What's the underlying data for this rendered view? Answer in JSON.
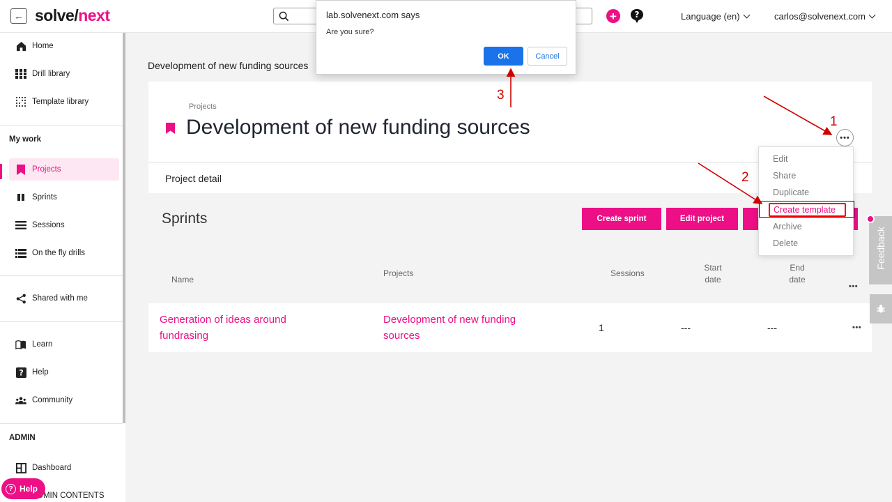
{
  "topbar": {
    "logo_part1": "solve/",
    "logo_part2": "next",
    "language": "Language (en)",
    "user_email": "carlos@solvenext.com"
  },
  "sidebar": {
    "items": [
      {
        "label": "Home"
      },
      {
        "label": "Drill library"
      },
      {
        "label": "Template library"
      }
    ],
    "my_work_label": "My work",
    "work_items": [
      {
        "label": "Projects"
      },
      {
        "label": "Sprints"
      },
      {
        "label": "Sessions"
      },
      {
        "label": "On the fly drills"
      }
    ],
    "shared_label": "Shared with me",
    "support_items": [
      {
        "label": "Learn"
      },
      {
        "label": "Help"
      },
      {
        "label": "Community"
      }
    ],
    "admin_label": "ADMIN",
    "admin_items": [
      {
        "label": "Dashboard"
      },
      {
        "label": "ADMIN CONTENTS"
      }
    ],
    "help_pill": "Help"
  },
  "main": {
    "breadcrumb": "Development of new funding sources",
    "project_small_label": "Projects",
    "project_title": "Development of new funding sources",
    "tab_label": "Project detail",
    "sprints_title": "Sprints",
    "buttons": {
      "create_sprint": "Create sprint",
      "edit_project": "Edit project"
    },
    "table": {
      "headers": {
        "name": "Name",
        "projects": "Projects",
        "sessions": "Sessions",
        "start_date_1": "Start",
        "start_date_2": "date",
        "end_date_1": "End",
        "end_date_2": "date"
      },
      "rows": [
        {
          "name_line1": "Generation of ideas around",
          "name_line2": "fundrasing",
          "project_line1": "Development of new funding",
          "project_line2": "sources",
          "sessions": "1",
          "start": "---",
          "end": "---"
        }
      ]
    }
  },
  "menu": {
    "items": [
      "Edit",
      "Share",
      "Duplicate",
      "Create template",
      "Archive",
      "Delete"
    ]
  },
  "feedback_label": "Feedback",
  "dialog": {
    "title": "lab.solvenext.com says",
    "message": "Are you sure?",
    "ok": "OK",
    "cancel": "Cancel"
  },
  "annotations": [
    "1",
    "2",
    "3"
  ],
  "colors": {
    "brand": "#ec0f86",
    "dialog_primary": "#1a73e8",
    "annotation": "#d00000"
  }
}
